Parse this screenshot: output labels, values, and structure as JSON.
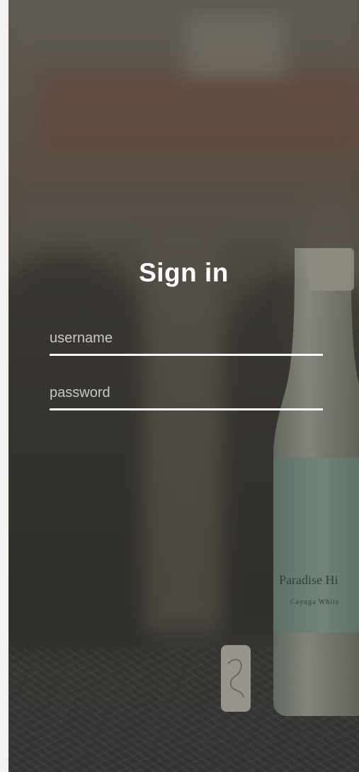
{
  "form": {
    "title": "Sign in",
    "username_placeholder": "username",
    "password_placeholder": "password"
  },
  "bottle_label": {
    "line1": "Paradise Hi",
    "line2": "Cayuga White"
  },
  "colors": {
    "text": "#ffffff",
    "underline": "#ffffff",
    "page_background": "#f2f2f2"
  }
}
